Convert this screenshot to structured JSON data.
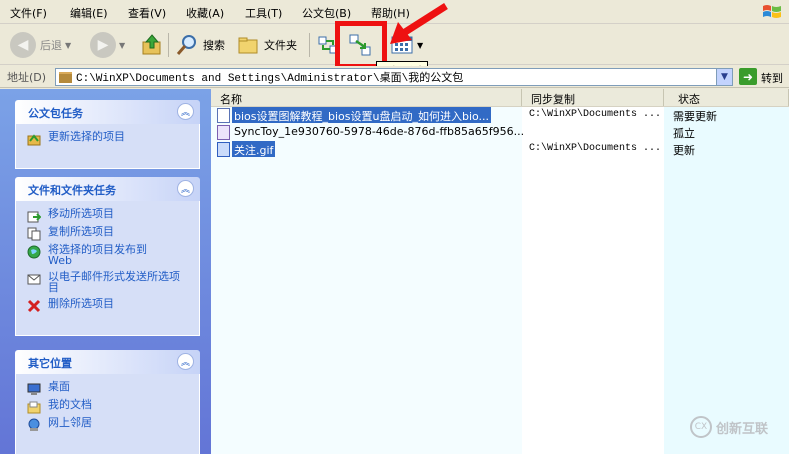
{
  "menu": [
    "文件(F)",
    "编辑(E)",
    "查看(V)",
    "收藏(A)",
    "工具(T)",
    "公文包(B)",
    "帮助(H)"
  ],
  "toolbar": {
    "back_label": "后退",
    "search_label": "搜索",
    "folders_label": "文件夹",
    "tooltip": "更新所选"
  },
  "address": {
    "label": "地址(D)",
    "path": "C:\\WinXP\\Documents and Settings\\Administrator\\桌面\\我的公文包",
    "go_label": "转到"
  },
  "taskpane": {
    "briefcase": {
      "title": "公文包任务",
      "items": [
        {
          "label": "更新选择的项目",
          "icon": "briefcase-update-icon"
        }
      ]
    },
    "filetasks": {
      "title": "文件和文件夹任务",
      "items": [
        {
          "label": "移动所选项目",
          "icon": "move-icon"
        },
        {
          "label": "复制所选项目",
          "icon": "copy-icon"
        },
        {
          "label": "将选择的项目发布到 Web",
          "icon": "publish-web-icon"
        },
        {
          "label": "以电子邮件形式发送所选项目",
          "icon": "email-icon"
        },
        {
          "label": "删除所选项目",
          "icon": "delete-icon"
        }
      ]
    },
    "otherplaces": {
      "title": "其它位置",
      "items": [
        {
          "label": "桌面",
          "icon": "desktop-icon"
        },
        {
          "label": "我的文档",
          "icon": "my-documents-icon"
        },
        {
          "label": "网上邻居",
          "icon": "network-places-icon"
        }
      ]
    }
  },
  "list": {
    "columns": [
      "名称",
      "同步复制",
      "状态"
    ],
    "rows": [
      {
        "name": "bios设置图解教程_bios设置u盘启动_如何进入bio...",
        "sync": "C:\\WinXP\\Documents ...",
        "state": "需要更新",
        "selected": true
      },
      {
        "name": "SyncToy_1e930760-5978-46de-876d-ffb85a65f956...",
        "sync": "",
        "state": "孤立",
        "selected": false
      },
      {
        "name": "关注.gif",
        "sync": "C:\\WinXP\\Documents ...",
        "state": "更新",
        "selected": true
      }
    ]
  },
  "watermark": {
    "text": "创新互联",
    "icon_text": "CX"
  },
  "colors": {
    "highlight": "#316ac5",
    "annotation_red": "#ee1111",
    "taskpane_blue": "#6375d6"
  }
}
